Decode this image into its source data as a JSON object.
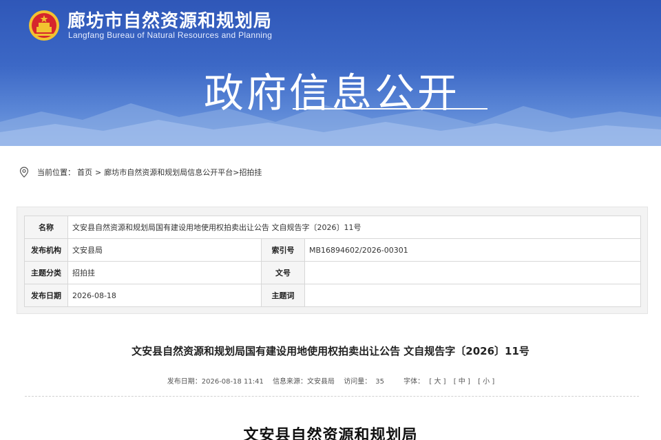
{
  "header": {
    "site_title": "廊坊市自然资源和规划局",
    "site_subtitle": "Langfang Bureau of Natural Resources and Planning",
    "banner_heading": "政府信息公开",
    "emblem_icon": "national-emblem-icon"
  },
  "breadcrumb": {
    "icon": "location-pin-icon",
    "prefix": "当前位置：",
    "home": "首页",
    "separator": ">",
    "platform": "廊坊市自然资源和规划局信息公开平台",
    "separator2": ">",
    "current": "招拍挂"
  },
  "info_table": {
    "name_label": "名称",
    "name_value": "文安县自然资源和规划局国有建设用地使用权拍卖出让公告 文自规告字〔2026〕11号",
    "publisher_label": "发布机构",
    "publisher_value": "文安县局",
    "index_label": "索引号",
    "index_value": "MB16894602/2026-00301",
    "category_label": "主题分类",
    "category_value": "招拍挂",
    "docno_label": "文号",
    "docno_value": "",
    "date_label": "发布日期",
    "date_value": "2026-08-18",
    "keywords_label": "主题词",
    "keywords_value": ""
  },
  "article": {
    "title": "文安县自然资源和规划局国有建设用地使用权拍卖出让公告 文自规告字〔2026〕11号",
    "publish_date": "发布日期：2026-08-18 11:41",
    "source": "信息来源：文安县局",
    "visits_label": "访问量：",
    "visits_value": "35",
    "font_label": "字体：",
    "font_large": "[ 大 ]",
    "font_medium": "[ 中 ]",
    "font_small": "[ 小 ]",
    "doc_heading": "文安县自然资源和规划局"
  },
  "colors": {
    "banner_top": "#2f57b8",
    "banner_bottom": "#7aa2e0",
    "label_bg": "#f5f5f5"
  }
}
